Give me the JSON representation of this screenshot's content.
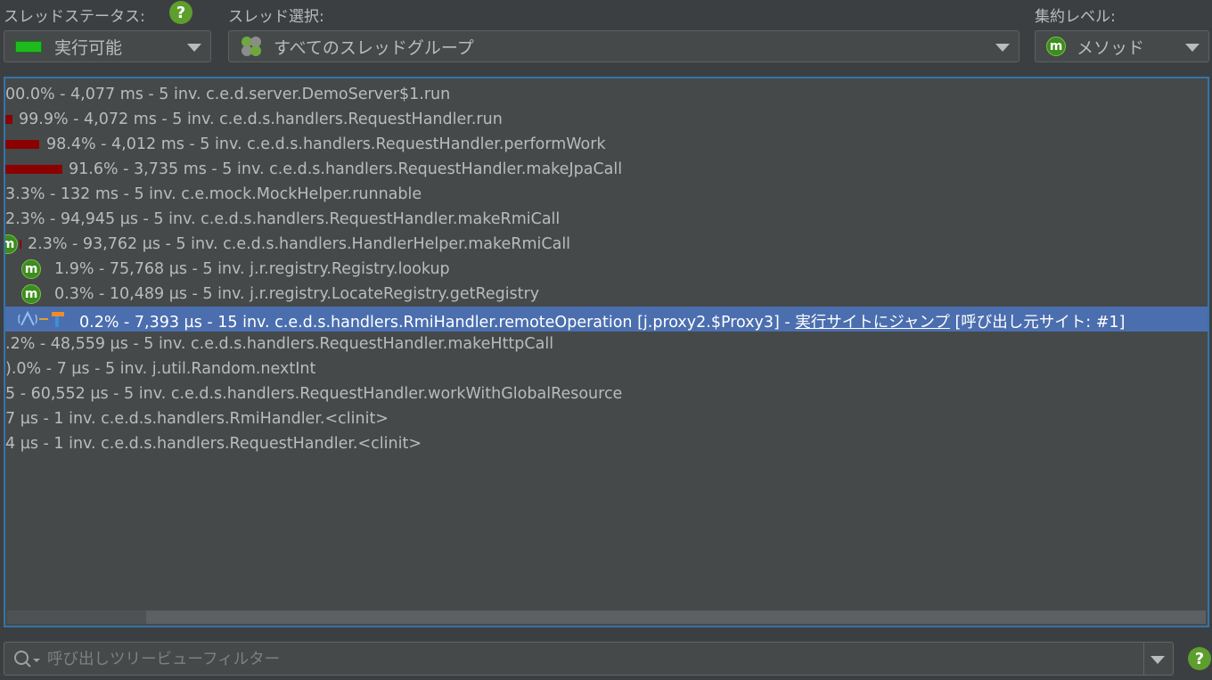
{
  "toolbar": {
    "thread_status_label": "スレッドステータス:",
    "thread_status_value": "実行可能",
    "thread_select_label": "スレッド選択:",
    "thread_select_value": "すべてのスレッドグループ",
    "aggregation_label": "集約レベル:",
    "aggregation_value": "メソッド",
    "help_glyph": "?",
    "method_glyph": "m"
  },
  "tree": {
    "rows": [
      {
        "text": "00.0% - 4,077 ms - 5 inv. c.e.d.server.DemoServer$1.run"
      },
      {
        "text": "99.9% - 4,072 ms - 5 inv. c.e.d.s.handlers.RequestHandler.run"
      },
      {
        "text": "98.4% - 4,012 ms - 5 inv. c.e.d.s.handlers.RequestHandler.performWork"
      },
      {
        "text": "91.6% - 3,735 ms - 5 inv. c.e.d.s.handlers.RequestHandler.makeJpaCall"
      },
      {
        "text": "3.3% - 132 ms - 5 inv. c.e.mock.MockHelper.runnable"
      },
      {
        "text": "2.3% - 94,945 µs - 5 inv. c.e.d.s.handlers.RequestHandler.makeRmiCall"
      },
      {
        "text": "2.3% - 93,762 µs - 5 inv. c.e.d.s.handlers.HandlerHelper.makeRmiCall"
      },
      {
        "text": "1.9% - 75,768 µs - 5 inv. j.r.registry.Registry.lookup"
      },
      {
        "text": "0.3% - 10,489 µs - 5 inv. j.r.registry.LocateRegistry.getRegistry"
      },
      {
        "text": "0.2% - 7,393 µs - 15 inv. c.e.d.s.handlers.RmiHandler.remoteOperation [j.proxy2.$Proxy3] - ",
        "link": "実行サイトにジャンプ",
        "suffix": " [呼び出し元サイト: #1]"
      },
      {
        "text": ".2% - 48,559 µs - 5 inv. c.e.d.s.handlers.RequestHandler.makeHttpCall"
      },
      {
        "text": ").0% - 7 µs - 5 inv. j.util.Random.nextInt"
      },
      {
        "text": "5 - 60,552 µs - 5 inv. c.e.d.s.handlers.RequestHandler.workWithGlobalResource"
      },
      {
        "text": " 7 µs - 1 inv. c.e.d.s.handlers.RmiHandler.<clinit>"
      },
      {
        "text": "4 µs - 1 inv. c.e.d.s.handlers.RequestHandler.<clinit>"
      }
    ]
  },
  "filter": {
    "placeholder": "呼び出しツリービューフィルター",
    "value": ""
  },
  "colors": {
    "background": "#3c3f41",
    "panel": "#45494a",
    "selection": "#4b6eaf",
    "focus_border": "#3574a8",
    "bar": "#8b0000",
    "runnable_green": "#1fba1f",
    "help_green": "#5d9e2d"
  }
}
